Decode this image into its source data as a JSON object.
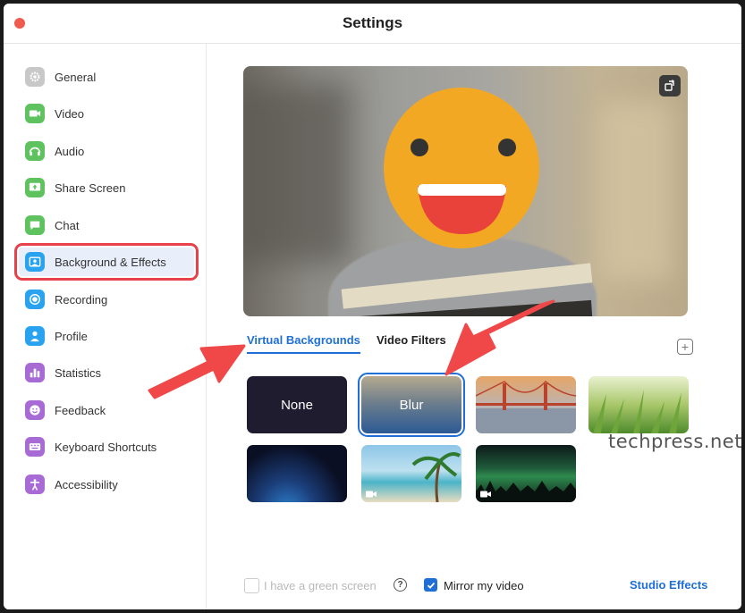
{
  "window": {
    "title": "Settings"
  },
  "sidebar": {
    "items": [
      {
        "label": "General",
        "icon": "gear-icon",
        "color": "#c8c8c8"
      },
      {
        "label": "Video",
        "icon": "video-icon",
        "color": "#5ec35e"
      },
      {
        "label": "Audio",
        "icon": "headphones-icon",
        "color": "#5ec35e"
      },
      {
        "label": "Share Screen",
        "icon": "share-screen-icon",
        "color": "#5ec35e"
      },
      {
        "label": "Chat",
        "icon": "chat-icon",
        "color": "#5ec35e"
      },
      {
        "label": "Background & Effects",
        "icon": "background-icon",
        "color": "#29a3ef",
        "active": true
      },
      {
        "label": "Recording",
        "icon": "record-icon",
        "color": "#29a3ef"
      },
      {
        "label": "Profile",
        "icon": "person-icon",
        "color": "#29a3ef"
      },
      {
        "label": "Statistics",
        "icon": "bar-chart-icon",
        "color": "#a86bd6"
      },
      {
        "label": "Feedback",
        "icon": "smile-icon",
        "color": "#a86bd6"
      },
      {
        "label": "Keyboard Shortcuts",
        "icon": "keyboard-icon",
        "color": "#a86bd6"
      },
      {
        "label": "Accessibility",
        "icon": "accessibility-icon",
        "color": "#a86bd6"
      }
    ]
  },
  "main": {
    "tabs": [
      {
        "label": "Virtual Backgrounds",
        "active": true
      },
      {
        "label": "Video Filters",
        "active": false
      }
    ],
    "backgrounds": [
      {
        "label": "None",
        "kind": "none"
      },
      {
        "label": "Blur",
        "kind": "blur",
        "selected": true
      },
      {
        "label": "",
        "kind": "golden-gate"
      },
      {
        "label": "",
        "kind": "grass"
      },
      {
        "label": "",
        "kind": "earth"
      },
      {
        "label": "",
        "kind": "beach",
        "video": true
      },
      {
        "label": "",
        "kind": "aurora",
        "video": true
      }
    ],
    "green_screen_label": "I have a green screen",
    "green_screen_checked": false,
    "mirror_label": "Mirror my video",
    "mirror_checked": true,
    "studio_effects_label": "Studio Effects"
  },
  "watermark": "techpress.net",
  "colors": {
    "accent": "#1f6fd6",
    "highlight": "#e8414a",
    "arrow": "#f04848"
  }
}
